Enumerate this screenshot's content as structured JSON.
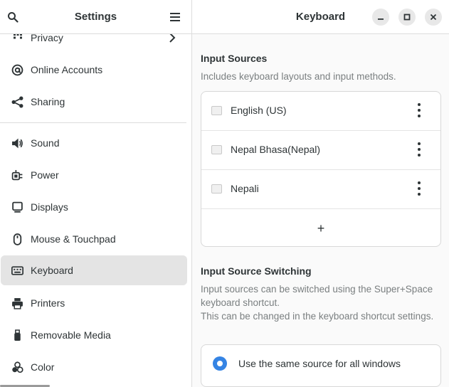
{
  "sidebar": {
    "title": "Settings",
    "items": [
      {
        "label": "Privacy",
        "icon": "privacy-icon"
      },
      {
        "label": "Online Accounts",
        "icon": "at-sign-icon"
      },
      {
        "label": "Sharing",
        "icon": "share-icon"
      },
      {
        "label": "Sound",
        "icon": "speaker-icon"
      },
      {
        "label": "Power",
        "icon": "power-plug-icon"
      },
      {
        "label": "Displays",
        "icon": "monitor-icon"
      },
      {
        "label": "Mouse & Touchpad",
        "icon": "mouse-icon"
      },
      {
        "label": "Keyboard",
        "icon": "keyboard-icon",
        "active": true
      },
      {
        "label": "Printers",
        "icon": "printer-icon"
      },
      {
        "label": "Removable Media",
        "icon": "usb-drive-icon"
      },
      {
        "label": "Color",
        "icon": "color-palette-icon"
      }
    ]
  },
  "main": {
    "title": "Keyboard",
    "input_sources": {
      "title": "Input Sources",
      "description": "Includes keyboard layouts and input methods.",
      "sources": [
        {
          "name": "English (US)"
        },
        {
          "name": "Nepal Bhasa(Nepal)"
        },
        {
          "name": "Nepali"
        }
      ],
      "add_label": "+"
    },
    "switching": {
      "title": "Input Source Switching",
      "description_1": "Input sources can be switched using the Super+Space keyboard shortcut.",
      "description_2": "This can be changed in the keyboard shortcut settings.",
      "option_same": "Use the same source for all windows",
      "option_same_selected": true
    }
  },
  "colors": {
    "accent": "#3584e4",
    "active_item_bg": "#e4e4e4"
  }
}
